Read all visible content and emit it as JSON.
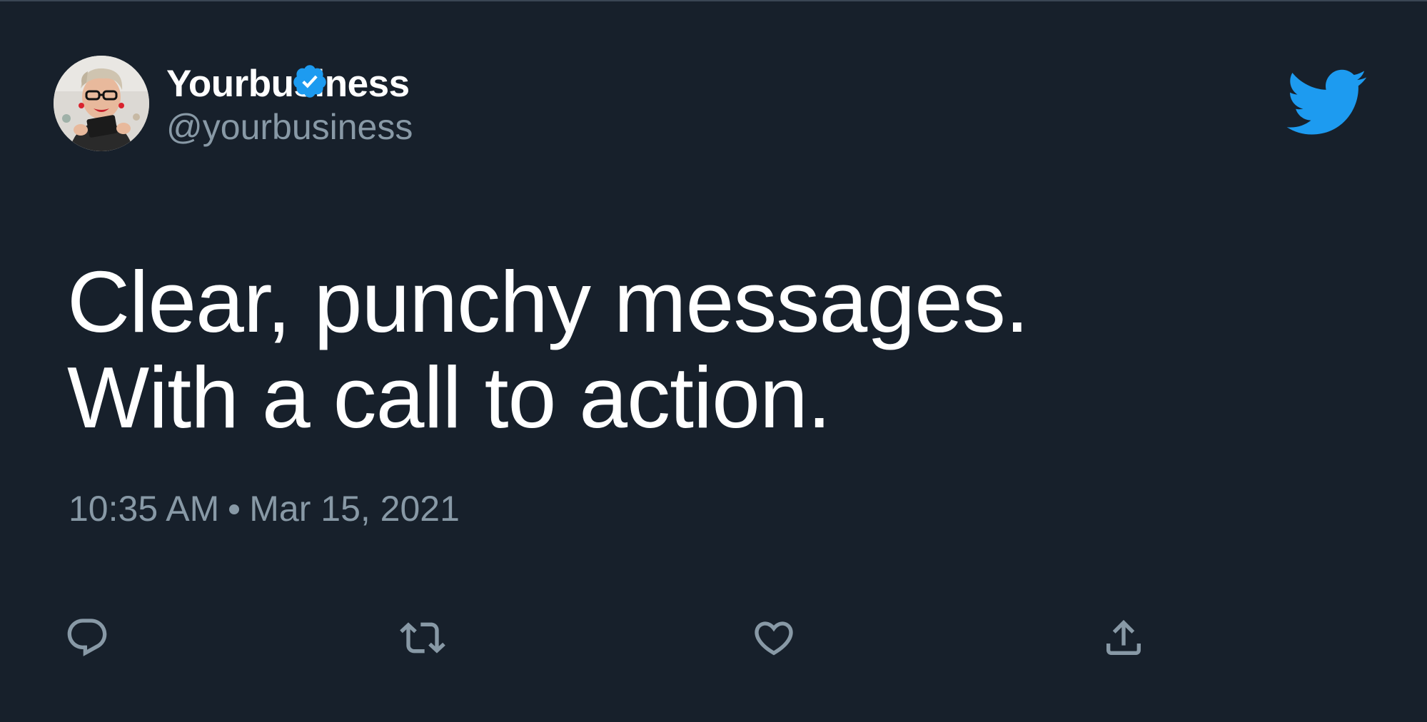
{
  "tweet": {
    "author": {
      "display_name": "Yourbusiness",
      "handle": "@yourbusiness",
      "verified": true
    },
    "text_lines": [
      "Clear, punchy messages.",
      "With a call to action."
    ],
    "time": "10:35 AM",
    "date": "Mar 15, 2021"
  },
  "icons": {
    "brand": "twitter-bird-icon",
    "verified": "verified-badge-icon",
    "reply": "reply-icon",
    "retweet": "retweet-icon",
    "like": "heart-icon",
    "share": "share-icon"
  },
  "colors": {
    "background": "#17202b",
    "text_primary": "#ffffff",
    "text_secondary": "#8899a6",
    "brand_blue": "#1d9bf0"
  }
}
